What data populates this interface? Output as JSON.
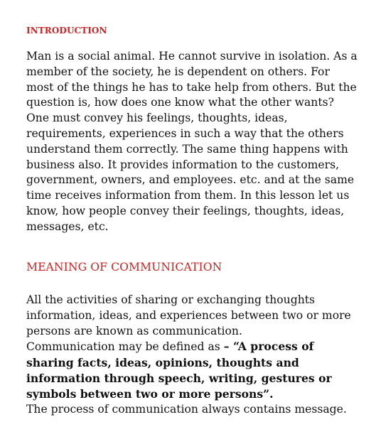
{
  "colors": {
    "heading_red": "#d61f1f",
    "text": "#111111"
  },
  "introduction": {
    "heading": "INTRODUCTION",
    "lines": [
      "Man is a social animal. He cannot survive in isolation. As a",
      "member of the society, he is dependent on others. For",
      "most of the things he has to take help from others. But the",
      "question is, how does one know what the other wants?",
      "One must convey his feelings, thoughts, ideas,",
      "requirements, experiences in such a way that the others",
      "understand them correctly. The same thing happens with",
      "business also. It provides information to the customers,",
      "government, owners, and employees. etc. and at the same",
      "time receives information from them. In this lesson let us",
      "know, how people convey their feelings, thoughts, ideas,",
      "messages, etc."
    ]
  },
  "meaning": {
    "heading": "MEANING OF COMMUNICATION",
    "line1": "All the activities of sharing or exchanging thoughts",
    "line2": "information, ideas, and experiences between two or more",
    "line3": "persons are known as communication.",
    "line4_prefix": "Communication may be defined as ",
    "line4_bold": "– “A process of",
    "bold_lines": [
      "sharing facts, ideas, opinions, thoughts and",
      "information through speech, writing, gestures or",
      "symbols between two or more persons”."
    ],
    "last_line": "The process of communication always contains message."
  }
}
